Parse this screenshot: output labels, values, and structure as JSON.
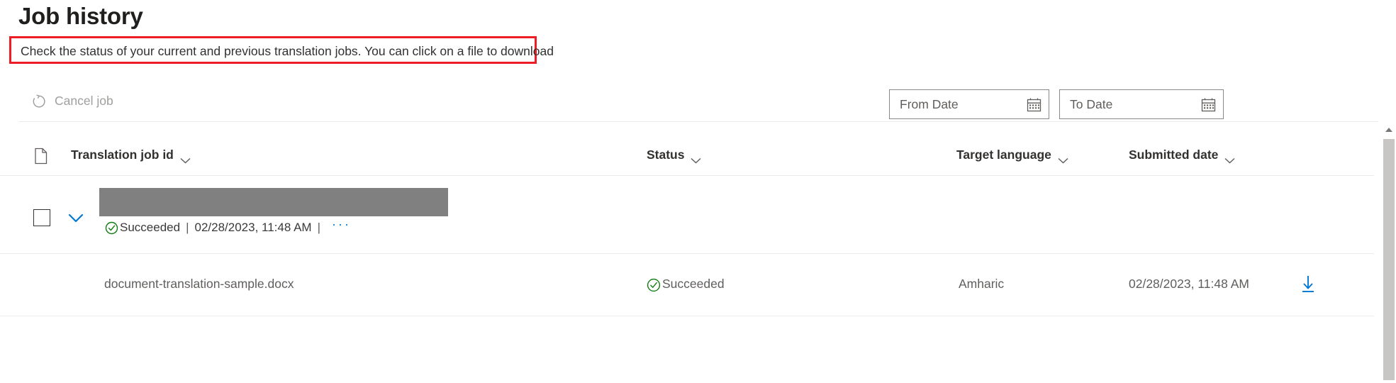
{
  "header": {
    "title": "Job history",
    "subtitle": "Check the status of your current and previous translation jobs. You can click on a file to download",
    "highlight_color": "#ee1c25"
  },
  "toolbar": {
    "cancel_job_label": "Cancel job",
    "cancel_job_icon": "circular-arrow-icon",
    "cancel_job_disabled": true,
    "from_date": {
      "placeholder": "From Date",
      "value": "",
      "icon": "calendar-icon"
    },
    "to_date": {
      "placeholder": "To Date",
      "value": "",
      "icon": "calendar-icon"
    }
  },
  "table": {
    "columns": [
      {
        "key": "file_icon",
        "label": "",
        "icon": "document-icon",
        "sortable": false
      },
      {
        "key": "job_id",
        "label": "Translation job id",
        "icon": "chevron-down-icon",
        "sortable": true
      },
      {
        "key": "status",
        "label": "Status",
        "icon": "chevron-down-icon",
        "sortable": true
      },
      {
        "key": "target_language",
        "label": "Target language",
        "icon": "chevron-down-icon",
        "sortable": true
      },
      {
        "key": "submitted_date",
        "label": "Submitted date",
        "icon": "chevron-down-icon",
        "sortable": true
      }
    ],
    "job_row": {
      "checkbox_checked": false,
      "expanded": true,
      "expand_icon": "chevron-down-icon",
      "job_id_redacted": true,
      "job_id_text": "",
      "status": "Succeeded",
      "status_icon": "check-circle-icon",
      "status_color": "#107c10",
      "separator": "|",
      "submitted_date": "02/28/2023, 11:48 AM",
      "overflow_menu": "···"
    },
    "file_row": {
      "file_name": "document-translation-sample.docx",
      "status": "Succeeded",
      "status_icon": "check-circle-icon",
      "status_color": "#107c10",
      "target_language": "Amharic",
      "submitted_date": "02/28/2023, 11:48 AM",
      "download_icon": "download-arrow-icon",
      "download_color": "#0078d4"
    }
  },
  "scrollbar": {
    "up_arrow_icon": "triangle-up-icon",
    "position": "top"
  }
}
